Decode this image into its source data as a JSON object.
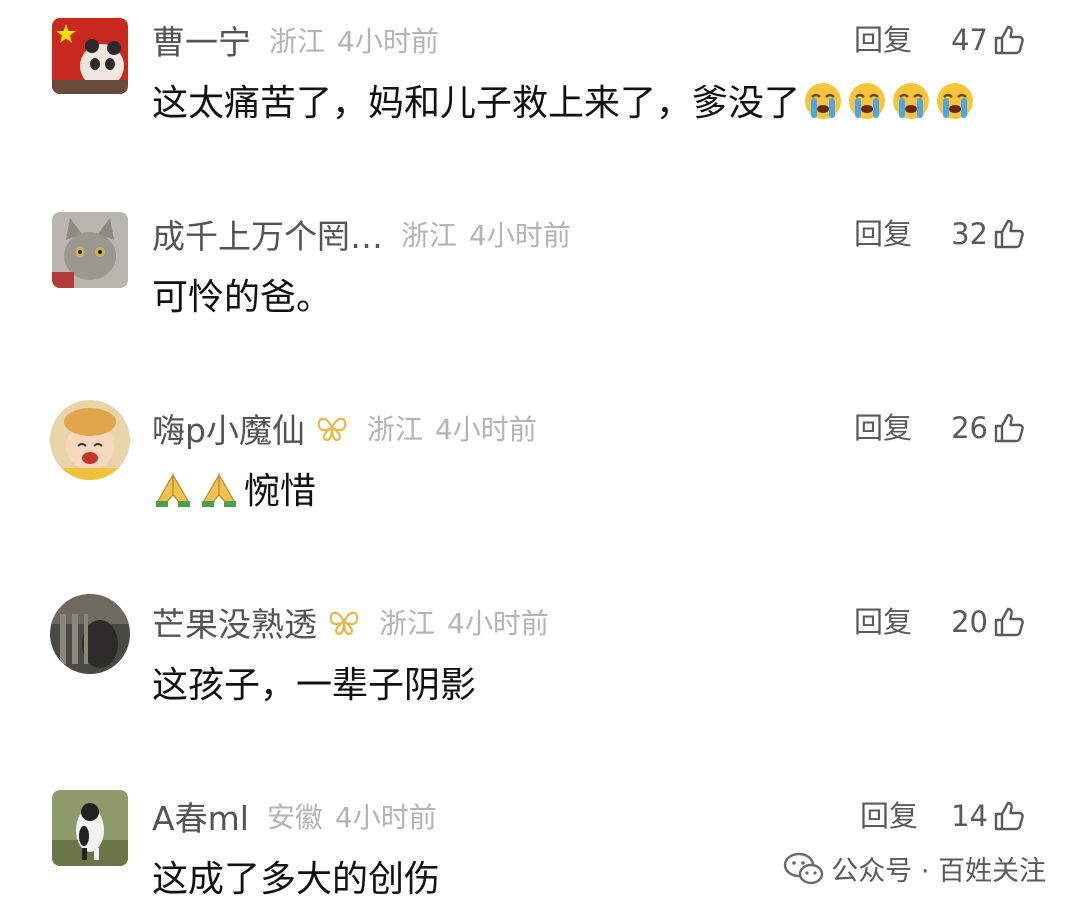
{
  "comments": [
    {
      "username": "曹一宁",
      "region": "浙江",
      "time": "4小时前",
      "reply_label": "回复",
      "likes": "47",
      "text": "这太痛苦了，妈和儿子救上来了，爹没了",
      "emojis": [
        "crying-face",
        "crying-face",
        "crying-face",
        "crying-face"
      ],
      "avatar_icon": "flag-panda-avatar"
    },
    {
      "username": "成千上万个罔…",
      "region": "浙江",
      "time": "4小时前",
      "reply_label": "回复",
      "likes": "32",
      "text": "可怜的爸。",
      "avatar_icon": "cat-avatar"
    },
    {
      "username": "嗨p小魔仙",
      "region": "浙江",
      "time": "4小时前",
      "reply_label": "回复",
      "likes": "26",
      "text": "惋惜",
      "emojis_before": [
        "praying-hands",
        "praying-hands"
      ],
      "avatar_icon": "baby-avatar",
      "badge_icon": "gold-butterfly-badge"
    },
    {
      "username": "芒果没熟透",
      "region": "浙江",
      "time": "4小时前",
      "reply_label": "回复",
      "likes": "20",
      "text": "这孩子，一辈子阴影",
      "avatar_icon": "photo-avatar",
      "badge_icon": "gold-butterfly-badge"
    },
    {
      "username": "A春ml",
      "region": "安徽",
      "time": "4小时前",
      "reply_label": "回复",
      "likes": "14",
      "text": "这成了多大的创伤",
      "avatar_icon": "dog-avatar"
    }
  ],
  "watermark": {
    "text": "公众号 · 百姓关注",
    "icon": "wechat-icon"
  },
  "colors": {
    "username": "#545454",
    "meta": "#b4b4b4",
    "text": "#111111",
    "badge": "#e8b84a"
  }
}
